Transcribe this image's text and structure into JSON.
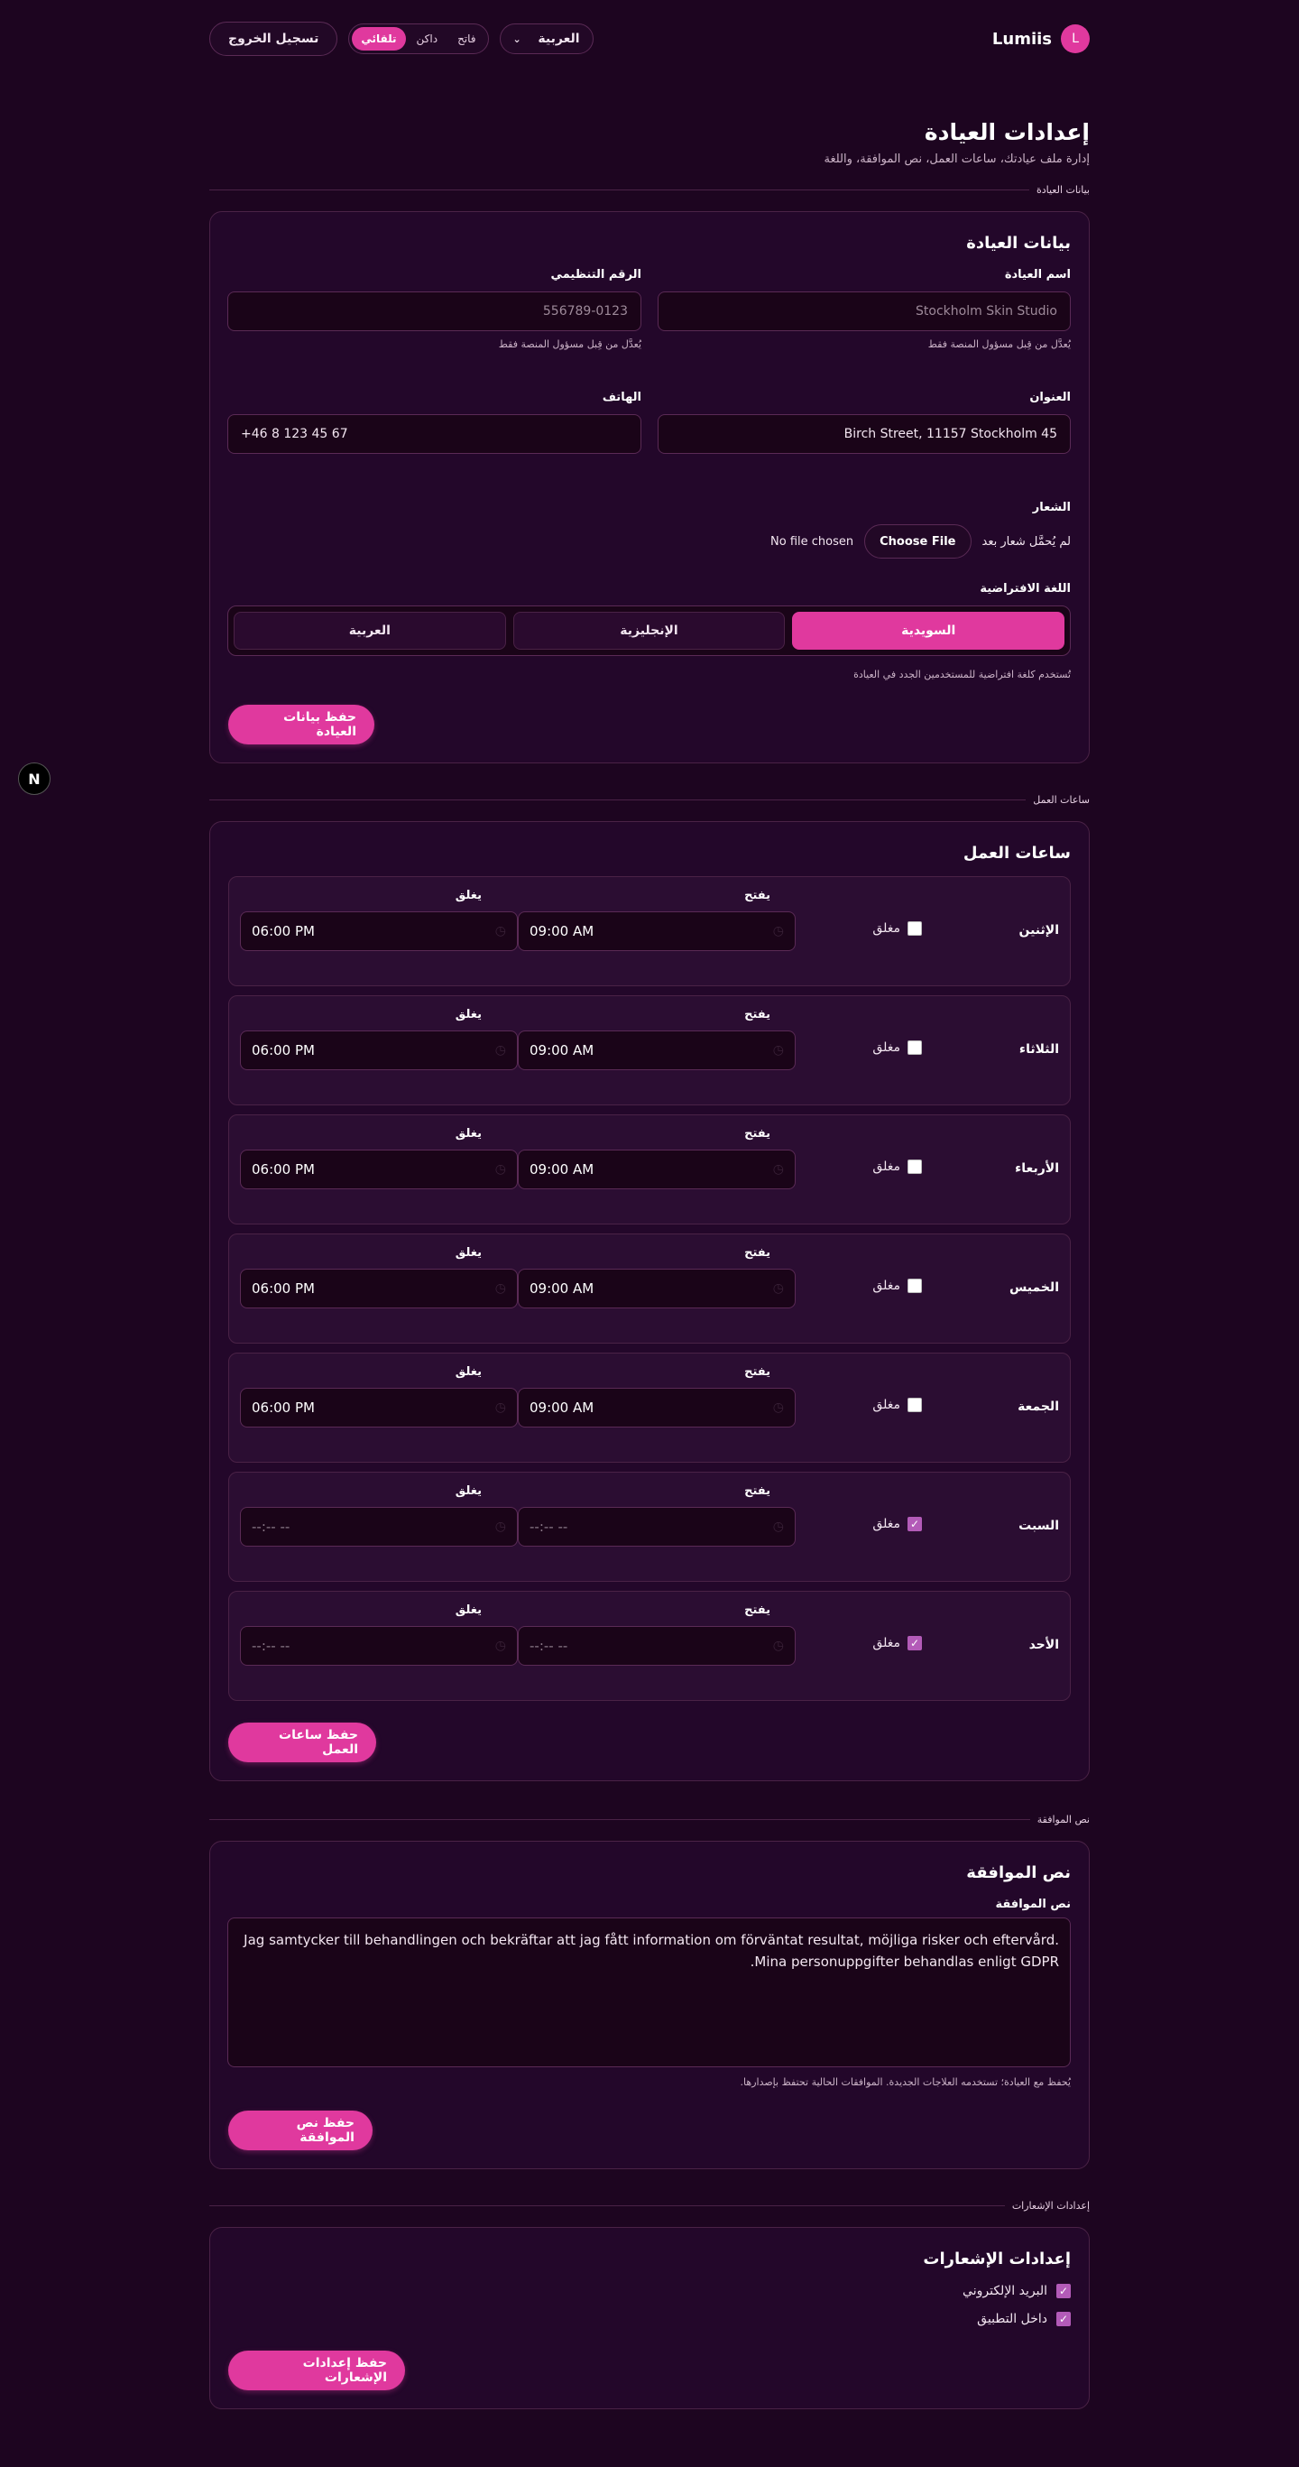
{
  "topbar": {
    "logout": "تسجيل الخروج",
    "theme_options": [
      "فاتح",
      "داكن",
      "تلقائي"
    ],
    "theme_active": "تلقائي",
    "language": "العربية",
    "brand": "Lumiis",
    "avatar_initial": "L"
  },
  "header": {
    "title": "إعدادات العيادة",
    "subtitle": "إدارة ملف عيادتك، ساعات العمل، نص الموافقة، واللغة"
  },
  "clinic": {
    "divider": "بيانات العيادة",
    "title": "بيانات العيادة",
    "name_label": "اسم العيادة",
    "name_value": "Stockholm Skin Studio",
    "name_hint": "يُعدَّل من قِبل مسؤول المنصة فقط",
    "org_label": "الرقم التنظيمي",
    "org_value": "556789-0123",
    "org_hint": "يُعدَّل من قِبل مسؤول المنصة فقط",
    "address_label": "العنوان",
    "address_value": "Birch Street, 11157 Stockholm 45",
    "phone_label": "الهاتف",
    "phone_value": "+46 8 123 45 67",
    "logo_label": "الشعار",
    "logo_none": "لم يُحمَّل شعار بعد",
    "choose_file": "Choose File",
    "no_file": "No file chosen",
    "lang_label": "اللغة الافتراضية",
    "lang_options": [
      "السويدية",
      "الإنجليزية",
      "العربية"
    ],
    "lang_active": "السويدية",
    "lang_hint": "تُستخدم كلغة افتراضية للمستخدمين الجدد في العيادة",
    "save": "حفظ بيانات العيادة"
  },
  "hours": {
    "divider": "ساعات العمل",
    "title": "ساعات العمل",
    "open_label": "يفتح",
    "close_label": "يغلق",
    "closed_label": "مغلق",
    "days": [
      {
        "name": "الإثنين",
        "open": "09:00 AM",
        "close": "06:00 PM",
        "closed": false
      },
      {
        "name": "الثلاثاء",
        "open": "09:00 AM",
        "close": "06:00 PM",
        "closed": false
      },
      {
        "name": "الأربعاء",
        "open": "09:00 AM",
        "close": "06:00 PM",
        "closed": false
      },
      {
        "name": "الخميس",
        "open": "09:00 AM",
        "close": "06:00 PM",
        "closed": false
      },
      {
        "name": "الجمعة",
        "open": "09:00 AM",
        "close": "06:00 PM",
        "closed": false
      },
      {
        "name": "السبت",
        "open": "--:-- --",
        "close": "--:-- --",
        "closed": true
      },
      {
        "name": "الأحد",
        "open": "--:-- --",
        "close": "--:-- --",
        "closed": true
      }
    ],
    "save": "حفظ ساعات العمل"
  },
  "consent": {
    "divider": "نص الموافقة",
    "title": "نص الموافقة",
    "field_label": "نص الموافقة",
    "text": "Jag samtycker till behandlingen och bekräftar att jag fått information om förväntat resultat, möjliga risker och eftervård. Mina personuppgifter behandlas enligt GDPR.",
    "hint": "يُحفظ مع العيادة؛ تستخدمه العلاجات الجديدة. الموافقات الحالية تحتفظ بإصدارها.",
    "save": "حفظ نص الموافقة"
  },
  "notifications": {
    "divider": "إعدادات الإشعارات",
    "title": "إعدادات الإشعارات",
    "email_label": "البريد الإلكتروني",
    "email_checked": true,
    "inapp_label": "داخل التطبيق",
    "inapp_checked": true,
    "save": "حفظ إعدادات الإشعارات"
  },
  "dev_badge": "N",
  "colors": {
    "background": "#1d0520",
    "card": "#23072a",
    "accent": "#e0399e",
    "border": "#4a2246"
  }
}
